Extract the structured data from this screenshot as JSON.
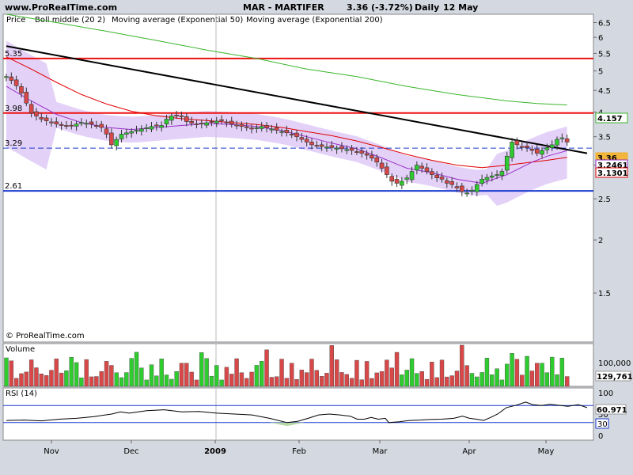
{
  "header": {
    "site": "www.ProRealTime.com",
    "title": "MAR - MARTIFER",
    "quote": "3.36 (-3.72%)",
    "period": "Daily",
    "date": "12 May"
  },
  "legend": {
    "price": "Price",
    "boll": "Boll middle (20 2)",
    "ema50": "Moving average (Exponential 50)",
    "ema200": "Moving average (Exponential 200)"
  },
  "copyright": "© ProRealTime.com",
  "colors": {
    "boll": "#9b30c8",
    "ema50": "#e00000",
    "ema200": "#39b52a",
    "trend": "#000000",
    "hline_red": "#ee1111",
    "hline_blue": "#1a3ccf",
    "dash": "#1a3ccf",
    "up": "#2fcc2f",
    "down": "#d94848",
    "band": "#d9c2f5"
  },
  "chart_data": [
    {
      "type": "candlestick",
      "panel": "price",
      "y_ticks": [
        "6.5",
        "6",
        "5.5",
        "5",
        "4.5",
        "4",
        "3.5",
        "3",
        "2.5",
        "2",
        "1.5"
      ],
      "x_ticks": [
        "Nov",
        "Dec",
        "2009",
        "Feb",
        "Mar",
        "Apr",
        "May"
      ],
      "ylim": [
        1.15,
        6.8
      ],
      "log_scale": true,
      "levels": [
        {
          "label": "5.35",
          "value": 5.35,
          "color": "red"
        },
        {
          "label": "3.98",
          "value": 3.98,
          "color": "red"
        },
        {
          "label": "3.29",
          "value": 3.29,
          "color": "blue-dashed"
        },
        {
          "label": "2.61",
          "value": 2.61,
          "color": "blue"
        }
      ],
      "last_values": [
        {
          "label": "4.157",
          "series": "ema200"
        },
        {
          "label": "3.36",
          "series": "price"
        },
        {
          "label": "3.2461",
          "series": "boll"
        },
        {
          "label": "3.1301",
          "series": "ema50"
        }
      ],
      "close_series": [
        [
          0,
          4.85
        ],
        [
          2,
          4.75
        ],
        [
          5,
          4.55
        ],
        [
          8,
          4.2
        ],
        [
          10,
          3.98
        ],
        [
          14,
          3.85
        ],
        [
          18,
          3.78
        ],
        [
          22,
          3.72
        ],
        [
          26,
          3.72
        ],
        [
          30,
          3.78
        ],
        [
          34,
          3.75
        ],
        [
          38,
          3.68
        ],
        [
          40,
          3.55
        ],
        [
          42,
          3.35
        ],
        [
          44,
          3.45
        ],
        [
          46,
          3.55
        ],
        [
          50,
          3.6
        ],
        [
          54,
          3.65
        ],
        [
          58,
          3.7
        ],
        [
          62,
          3.72
        ],
        [
          64,
          3.85
        ],
        [
          67,
          3.95
        ],
        [
          70,
          3.9
        ],
        [
          72,
          3.8
        ],
        [
          75,
          3.75
        ],
        [
          78,
          3.75
        ],
        [
          82,
          3.8
        ],
        [
          86,
          3.82
        ],
        [
          90,
          3.75
        ],
        [
          94,
          3.7
        ],
        [
          98,
          3.65
        ],
        [
          102,
          3.7
        ],
        [
          106,
          3.65
        ],
        [
          110,
          3.6
        ],
        [
          114,
          3.55
        ],
        [
          118,
          3.45
        ],
        [
          122,
          3.35
        ],
        [
          126,
          3.32
        ],
        [
          130,
          3.3
        ],
        [
          134,
          3.28
        ],
        [
          138,
          3.25
        ],
        [
          142,
          3.2
        ],
        [
          145,
          3.15
        ],
        [
          148,
          3.05
        ],
        [
          150,
          2.95
        ],
        [
          152,
          2.85
        ],
        [
          154,
          2.75
        ],
        [
          156,
          2.72
        ],
        [
          158,
          2.75
        ],
        [
          160,
          2.8
        ],
        [
          162,
          2.9
        ],
        [
          164,
          3.0
        ],
        [
          166,
          2.95
        ],
        [
          168,
          2.9
        ],
        [
          170,
          2.85
        ],
        [
          172,
          2.8
        ],
        [
          174,
          2.78
        ],
        [
          176,
          2.72
        ],
        [
          178,
          2.7
        ],
        [
          180,
          2.65
        ],
        [
          182,
          2.6
        ],
        [
          184,
          2.58
        ],
        [
          186,
          2.62
        ],
        [
          188,
          2.7
        ],
        [
          190,
          2.78
        ],
        [
          193,
          2.82
        ],
        [
          196,
          2.85
        ],
        [
          198,
          2.9
        ],
        [
          200,
          3.15
        ],
        [
          202,
          3.4
        ],
        [
          204,
          3.35
        ],
        [
          206,
          3.3
        ],
        [
          208,
          3.3
        ],
        [
          210,
          3.25
        ],
        [
          212,
          3.2
        ],
        [
          214,
          3.25
        ],
        [
          216,
          3.3
        ],
        [
          218,
          3.35
        ],
        [
          220,
          3.45
        ],
        [
          222,
          3.48
        ],
        [
          224,
          3.4
        ]
      ],
      "boll_middle": [
        [
          0,
          4.6
        ],
        [
          10,
          4.25
        ],
        [
          20,
          3.95
        ],
        [
          30,
          3.78
        ],
        [
          40,
          3.68
        ],
        [
          50,
          3.64
        ],
        [
          60,
          3.68
        ],
        [
          70,
          3.72
        ],
        [
          80,
          3.76
        ],
        [
          90,
          3.74
        ],
        [
          100,
          3.7
        ],
        [
          110,
          3.62
        ],
        [
          120,
          3.5
        ],
        [
          130,
          3.38
        ],
        [
          140,
          3.28
        ],
        [
          150,
          3.12
        ],
        [
          160,
          2.95
        ],
        [
          170,
          2.88
        ],
        [
          180,
          2.78
        ],
        [
          190,
          2.72
        ],
        [
          200,
          2.85
        ],
        [
          210,
          3.05
        ],
        [
          216,
          3.15
        ],
        [
          224,
          3.2461
        ]
      ],
      "ema50": [
        [
          0,
          5.4
        ],
        [
          10,
          5.05
        ],
        [
          20,
          4.7
        ],
        [
          30,
          4.4
        ],
        [
          40,
          4.18
        ],
        [
          50,
          4.02
        ],
        [
          60,
          3.92
        ],
        [
          70,
          3.86
        ],
        [
          80,
          3.82
        ],
        [
          90,
          3.78
        ],
        [
          100,
          3.74
        ],
        [
          110,
          3.68
        ],
        [
          120,
          3.6
        ],
        [
          130,
          3.52
        ],
        [
          140,
          3.42
        ],
        [
          150,
          3.3
        ],
        [
          160,
          3.18
        ],
        [
          170,
          3.08
        ],
        [
          180,
          3.0
        ],
        [
          190,
          2.96
        ],
        [
          200,
          3.0
        ],
        [
          210,
          3.05
        ],
        [
          216,
          3.08
        ],
        [
          224,
          3.1301
        ]
      ],
      "ema200": [
        [
          0,
          6.8
        ],
        [
          20,
          6.5
        ],
        [
          40,
          6.2
        ],
        [
          60,
          5.9
        ],
        [
          80,
          5.6
        ],
        [
          100,
          5.35
        ],
        [
          120,
          5.05
        ],
        [
          140,
          4.85
        ],
        [
          160,
          4.6
        ],
        [
          180,
          4.4
        ],
        [
          200,
          4.25
        ],
        [
          212,
          4.19
        ],
        [
          224,
          4.157
        ]
      ],
      "trendline": [
        [
          0,
          5.72
        ],
        [
          232,
          3.2
        ]
      ]
    },
    {
      "type": "bar",
      "panel": "volume",
      "label": "Volume",
      "last_value": "129,761",
      "y_tick": "100,000"
    },
    {
      "type": "line",
      "panel": "rsi",
      "label": "RSI (14)",
      "y_ticks": [
        "100",
        "50",
        "0"
      ],
      "levels": [
        "70",
        "30"
      ],
      "last_value": "60.971",
      "ylim": [
        0,
        100
      ],
      "values": [
        [
          0,
          35
        ],
        [
          10,
          36
        ],
        [
          20,
          34
        ],
        [
          30,
          38
        ],
        [
          40,
          40
        ],
        [
          50,
          44
        ],
        [
          60,
          50
        ],
        [
          65,
          55
        ],
        [
          70,
          52
        ],
        [
          80,
          58
        ],
        [
          90,
          60
        ],
        [
          100,
          55
        ],
        [
          110,
          56
        ],
        [
          120,
          52
        ],
        [
          130,
          50
        ],
        [
          140,
          48
        ],
        [
          150,
          40
        ],
        [
          155,
          35
        ],
        [
          160,
          30
        ],
        [
          166,
          33
        ],
        [
          172,
          40
        ],
        [
          178,
          48
        ],
        [
          184,
          50
        ],
        [
          190,
          48
        ],
        [
          196,
          45
        ],
        [
          200,
          38
        ],
        [
          204,
          38
        ],
        [
          208,
          42
        ],
        [
          212,
          38
        ],
        [
          216,
          40
        ],
        [
          218,
          30
        ],
        [
          224,
          32
        ],
        [
          230,
          35
        ],
        [
          236,
          36
        ],
        [
          240,
          37
        ],
        [
          248,
          38
        ],
        [
          255,
          40
        ],
        [
          260,
          45
        ],
        [
          264,
          40
        ],
        [
          268,
          38
        ],
        [
          272,
          35
        ],
        [
          276,
          42
        ],
        [
          280,
          50
        ],
        [
          285,
          65
        ],
        [
          290,
          70
        ],
        [
          296,
          78
        ],
        [
          300,
          72
        ],
        [
          305,
          70
        ],
        [
          310,
          73
        ],
        [
          316,
          70
        ],
        [
          320,
          68
        ],
        [
          326,
          72
        ],
        [
          331,
          65
        ]
      ]
    }
  ]
}
